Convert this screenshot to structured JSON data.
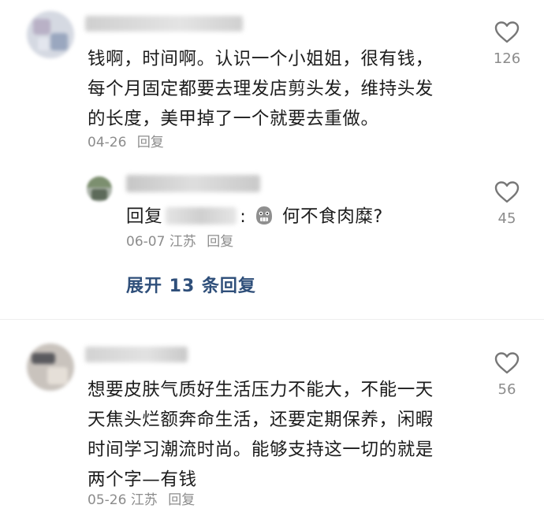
{
  "colors": {
    "text": "#1c1c1c",
    "meta": "#8c8c8c",
    "link": "#2f4f7a",
    "icon": "#777777"
  },
  "comments": [
    {
      "text": "钱啊，时间啊。认识一个小姐姐，很有钱，每个月固定都要去理发店剪头发，维持头发的长度，美甲掉了一个就要去重做。",
      "date": "04-26",
      "reply_label": "回复",
      "likes": "126",
      "like_icon": "heart-outline-icon",
      "replies": [
        {
          "text_prefix": "回复",
          "text_suffix": "何不食肉糜?",
          "emoji": "grimace-emoji-icon",
          "date": "06-07",
          "location": "江苏",
          "reply_label": "回复",
          "likes": "45"
        }
      ],
      "expand_label": "展开 13 条回复"
    },
    {
      "text": "想要皮肤气质好生活压力不能大，不能一天天焦头烂额奔命生活，还要定期保养，闲暇时间学习潮流时尚。能够支持这一切的就是两个字—有钱",
      "date": "05-26",
      "location": "江苏",
      "reply_label": "回复",
      "likes": "56"
    }
  ]
}
